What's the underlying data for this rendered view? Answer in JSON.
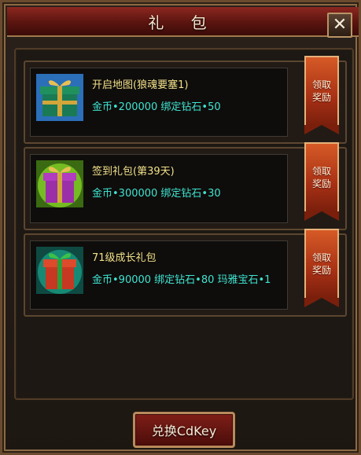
{
  "window": {
    "title": "礼 包",
    "close_icon": "close-icon"
  },
  "gifts": [
    {
      "name": "开启地图(狼魂要塞1)",
      "reward": "金币•200000 绑定钻石•50",
      "claim_line1": "领取",
      "claim_line2": "奖励",
      "box_color": "#1a7a55",
      "bg_color": "#2b6fb8",
      "ribbon_color": "#d2a63a"
    },
    {
      "name": "签到礼包(第39天)",
      "reward": "金币•300000 绑定钻石•30",
      "claim_line1": "领取",
      "claim_line2": "奖励",
      "box_color": "#9b2fa8",
      "bg_color": "#8fe02a",
      "ribbon_color": "#d2a63a"
    },
    {
      "name": "71级成长礼包",
      "reward": "金币•90000 绑定钻石•80 玛雅宝石•1",
      "claim_line1": "领取",
      "claim_line2": "奖励",
      "box_color": "#c63822",
      "bg_color": "#1aa58a",
      "ribbon_color": "#2f9c3a"
    }
  ],
  "footer": {
    "cdkey_label": "兑换CdKey"
  }
}
